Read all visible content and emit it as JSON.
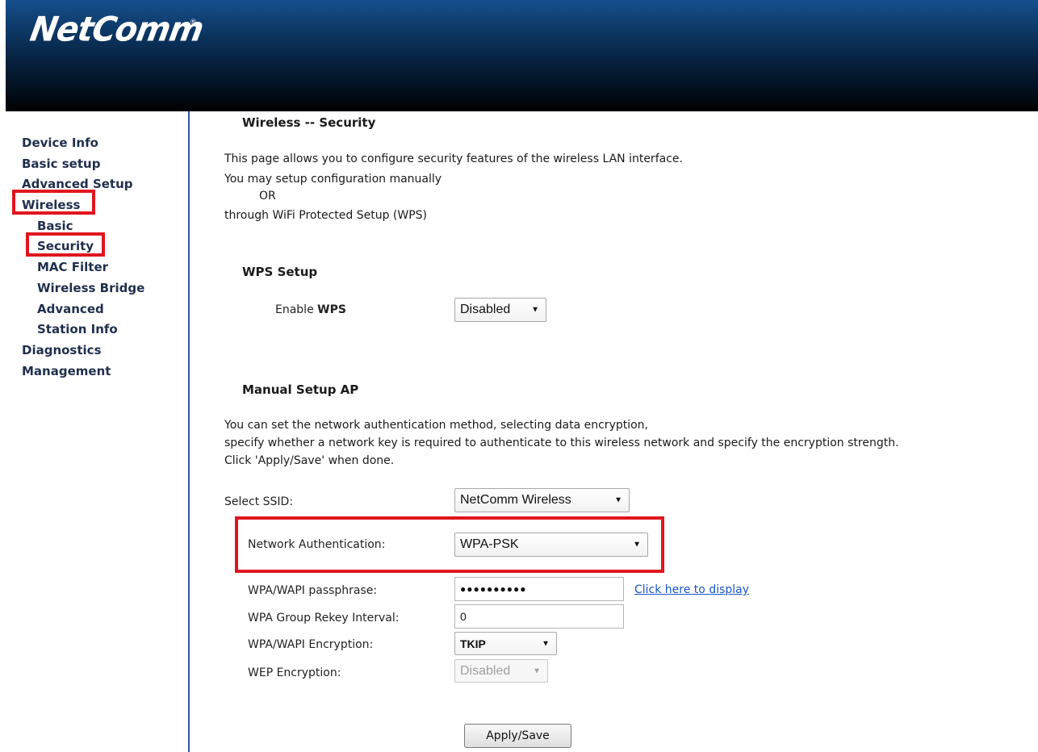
{
  "brand": {
    "logo_text": "NetComm",
    "logo_mark": "®"
  },
  "sidebar": {
    "items": [
      {
        "label": "Device Info",
        "level": "top"
      },
      {
        "label": "Basic setup",
        "level": "top"
      },
      {
        "label": "Advanced Setup",
        "level": "top"
      },
      {
        "label": "Wireless",
        "level": "top"
      },
      {
        "label": "Basic",
        "level": "sub"
      },
      {
        "label": "Security",
        "level": "sub"
      },
      {
        "label": "MAC Filter",
        "level": "sub"
      },
      {
        "label": "Wireless Bridge",
        "level": "sub"
      },
      {
        "label": "Advanced",
        "level": "sub"
      },
      {
        "label": "Station Info",
        "level": "sub"
      },
      {
        "label": "Diagnostics",
        "level": "top"
      },
      {
        "label": "Management",
        "level": "top"
      }
    ]
  },
  "page": {
    "title": "Wireless -- Security",
    "intro": [
      "This page allows you to configure security features of the wireless LAN interface.",
      "You may setup configuration manually",
      "OR",
      "through WiFi Protected Setup (WPS)"
    ]
  },
  "wps": {
    "heading": "WPS Setup",
    "enable_label_prefix": "Enable ",
    "enable_label_bold": "WPS",
    "enable_value": "Disabled"
  },
  "manual": {
    "heading": "Manual Setup AP",
    "desc": [
      "You can set the network authentication method, selecting data encryption,",
      "specify whether a network key is required to authenticate to this wireless network and specify the encryption strength.",
      "Click 'Apply/Save' when done."
    ],
    "ssid_label": "Select SSID:",
    "ssid_value": "NetComm Wireless",
    "auth_label": "Network Authentication:",
    "auth_value": "WPA-PSK",
    "passphrase_label": "WPA/WAPI passphrase:",
    "passphrase_value": "●●●●●●●●●●",
    "display_link": "Click here to display",
    "rekey_label": "WPA Group Rekey Interval:",
    "rekey_value": "0",
    "encryption_label": "WPA/WAPI Encryption:",
    "encryption_value": "TKIP",
    "wep_label": "WEP Encryption:",
    "wep_value": "Disabled",
    "apply_label": "Apply/Save"
  },
  "colors": {
    "highlight": "#e0161f",
    "sidebar_border": "#2f5aa8",
    "link": "#1a55c7",
    "nav_text": "#1f2f4d"
  }
}
